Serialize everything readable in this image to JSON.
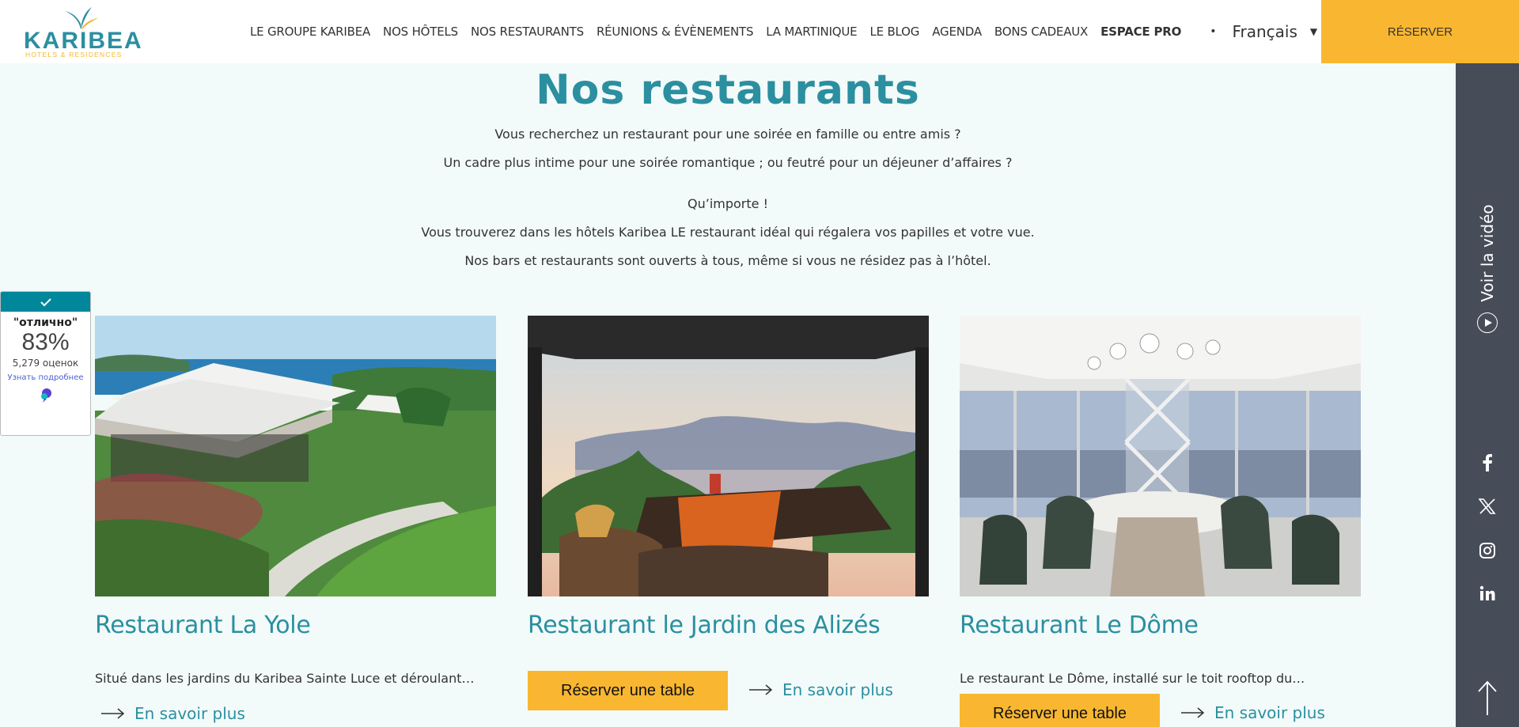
{
  "header": {
    "logo_text": "KARIBEA",
    "logo_subtitle": "HOTELS & RESIDENCES",
    "nav": [
      {
        "label": "LE GROUPE KARIBEA"
      },
      {
        "label": "NOS HÔTELS"
      },
      {
        "label": "NOS RESTAURANTS"
      },
      {
        "label": "RÉUNIONS & ÉVÈNEMENTS"
      },
      {
        "label": "LA MARTINIQUE"
      },
      {
        "label": "LE BLOG"
      },
      {
        "label": "AGENDA"
      },
      {
        "label": "BONS CADEAUX"
      },
      {
        "label": "ESPACE PRO"
      }
    ],
    "separator": "•",
    "language": "Français",
    "reserve_label": "RÉSERVER"
  },
  "page": {
    "title": "Nos restaurants",
    "intro": [
      "Vous recherchez un restaurant pour une soirée en famille ou entre amis ?",
      "Un cadre plus intime pour une soirée romantique ; ou feutré pour un déjeuner d’affaires ?",
      "Qu’importe !",
      "Vous trouverez dans les hôtels Karibea LE restaurant idéal qui régalera vos papilles et votre vue.",
      "Nos bars et restaurants sont ouverts à tous, même si vous ne résidez pas à l’hôtel."
    ]
  },
  "rating_widget": {
    "word": "\"отлично\"",
    "percent": "83%",
    "count": "5,279 оценок",
    "more_link": "Узнать подробнее"
  },
  "restaurants": [
    {
      "name": "Restaurant La Yole",
      "description": "Situé dans les jardins du Karibea Sainte Luce et déroulant…",
      "more_label": "En savoir plus"
    },
    {
      "name": "Restaurant le Jardin des Alizés",
      "book_label": "Réserver une table",
      "more_label": "En savoir plus"
    },
    {
      "name": "Restaurant Le Dôme",
      "description": "Le restaurant Le Dôme, installé sur le toit rooftop du…",
      "book_label": "Réserver une table",
      "more_label": "En savoir plus"
    }
  ],
  "sidebar": {
    "video_label": "Voir la vidéo",
    "social_icons": [
      "facebook-icon",
      "x-icon",
      "instagram-icon",
      "linkedin-icon"
    ]
  },
  "colors": {
    "accent": "#f9b731",
    "teal": "#2b8fa0",
    "sidebar": "#474c59",
    "background": "#f2fbfa"
  }
}
